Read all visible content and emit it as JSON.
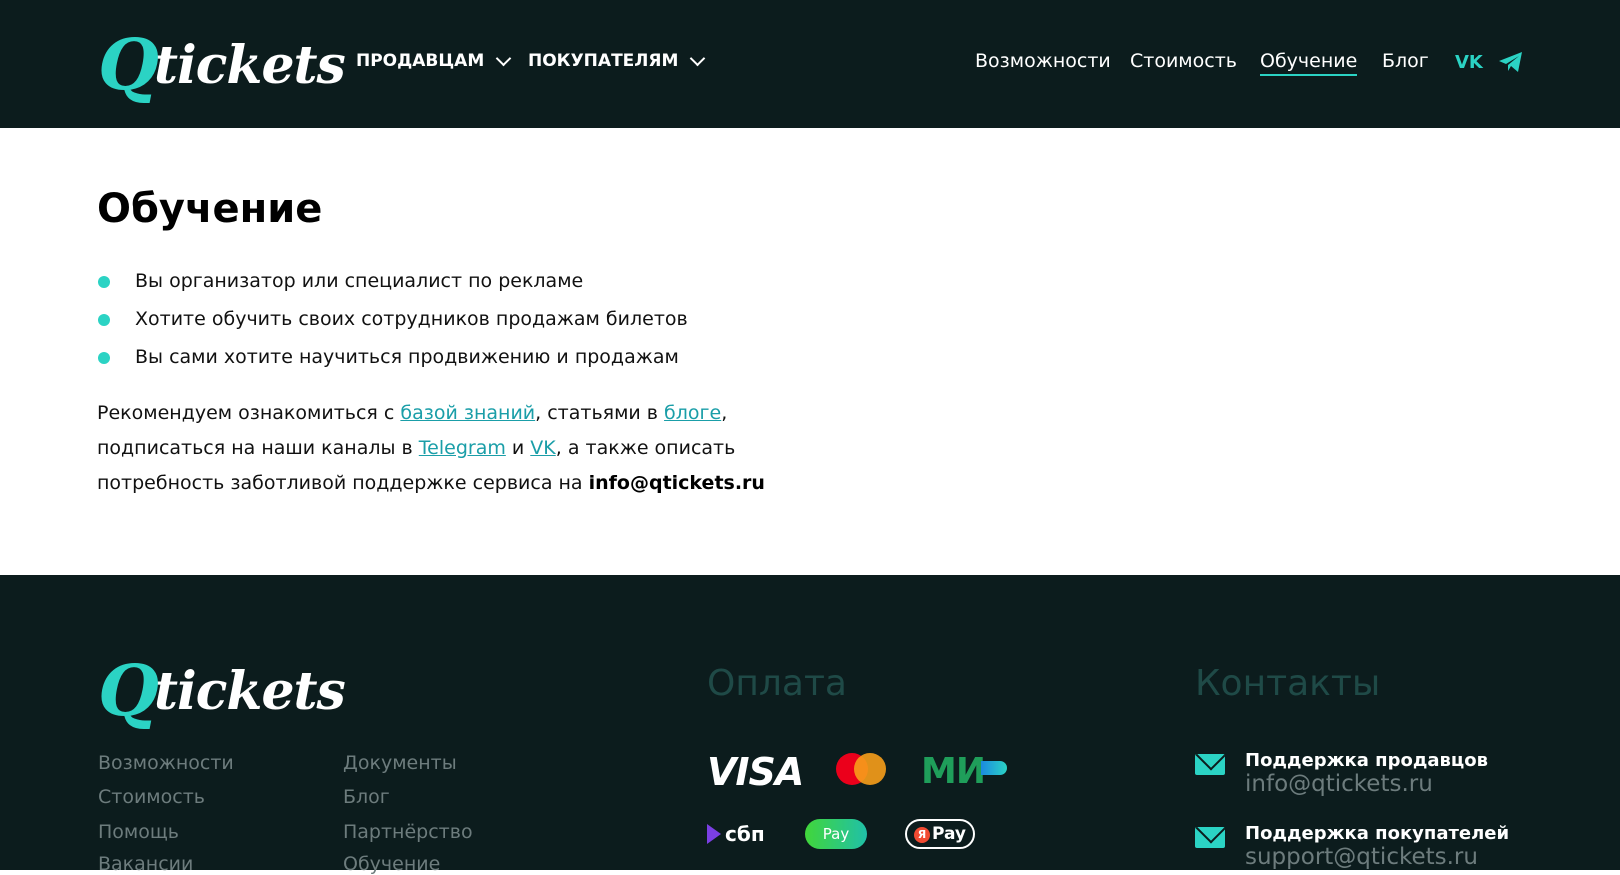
{
  "header": {
    "logo_q": "Q",
    "logo_text": "tickets",
    "dropdowns": [
      "ПРОДАВЦАМ",
      "ПОКУПАТЕЛЯМ"
    ],
    "links": [
      "Возможности",
      "Стоимость",
      "Обучение",
      "Блог"
    ],
    "active_link": "Обучение",
    "social": [
      "vk-icon",
      "telegram-icon"
    ],
    "vk_label": "VK"
  },
  "main": {
    "title": "Обучение",
    "bullets": [
      "Вы организатор или специалист по рекламе",
      "Хотите обучить своих сотрудников продажам билетов",
      "Вы сами хотите научиться продвижению и продажам"
    ],
    "para": {
      "t1": "Рекомендуем ознакомиться с ",
      "link1": "базой знаний",
      "t2": ", статьями в ",
      "link2": "блоге",
      "t3": ", подписаться на наши каналы в ",
      "link3": "Telegram",
      "t4": " и ",
      "link4": "VK",
      "t5": ", а также описать потребность заботливой поддержке сервиса на ",
      "email": "info@qtickets.ru"
    }
  },
  "footer": {
    "logo_q": "Q",
    "logo_text": "tickets",
    "col1": [
      "Возможности",
      "Стоимость",
      "Помощь",
      "Вакансии"
    ],
    "col2": [
      "Документы",
      "Блог",
      "Партнёрство",
      "Обучение"
    ],
    "payment_title": "Оплата",
    "payments": {
      "visa": "VISA",
      "mir": "МИ",
      "sbp": "сбп",
      "gpay": "Pay",
      "yapay": "Pay",
      "ya_letter": "Я"
    },
    "contacts_title": "Контакты",
    "contacts": [
      {
        "title": "Поддержка продавцов",
        "email": "info@qtickets.ru"
      },
      {
        "title": "Поддержка покупателей",
        "email": "support@qtickets.ru"
      }
    ]
  },
  "colors": {
    "accent": "#2bd3c4",
    "dark_bg": "#0c1c1d",
    "link": "#1a9ea8"
  }
}
